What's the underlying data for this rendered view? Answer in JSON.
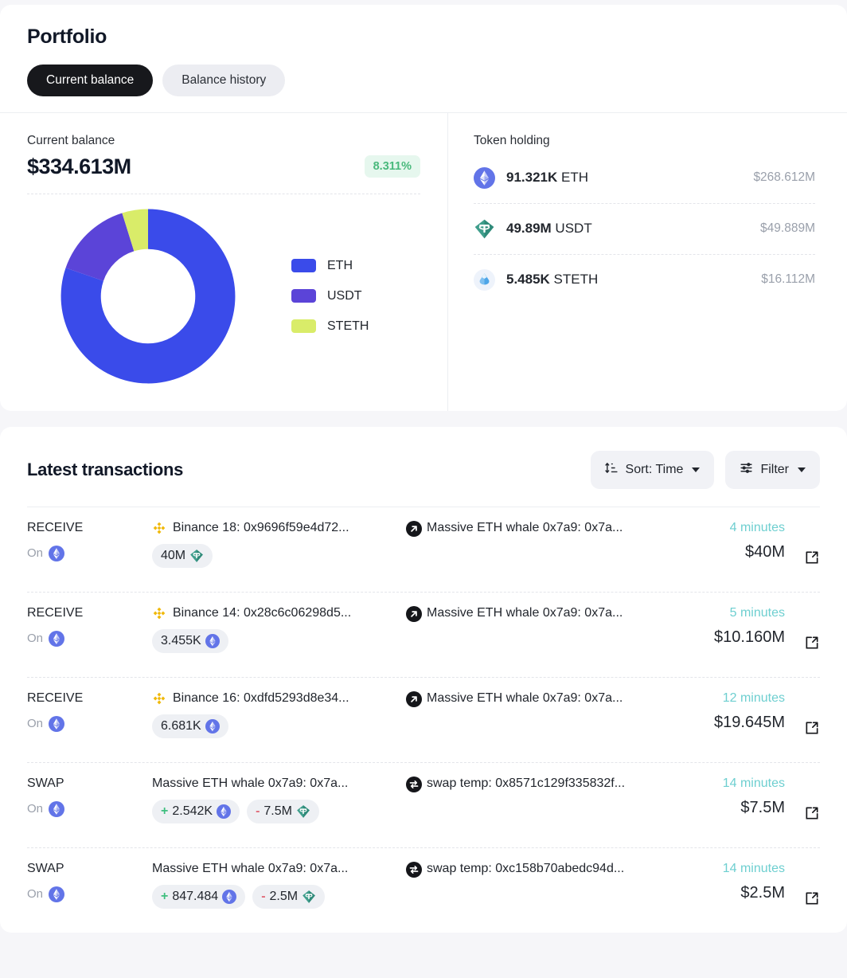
{
  "portfolio": {
    "title": "Portfolio",
    "tabs": [
      {
        "label": "Current balance",
        "active": true
      },
      {
        "label": "Balance history",
        "active": false
      }
    ],
    "balance": {
      "label": "Current balance",
      "amount": "$334.613M",
      "change": "8.311%",
      "change_color": "#49b97c"
    },
    "token_holding": {
      "title": "Token holding",
      "rows": [
        {
          "amount": "91.321K",
          "symbol": "ETH",
          "usd": "$268.612M",
          "icon": "eth-icon"
        },
        {
          "amount": "49.89M",
          "symbol": "USDT",
          "usd": "$49.889M",
          "icon": "usdt-icon"
        },
        {
          "amount": "5.485K",
          "symbol": "STETH",
          "usd": "$16.112M",
          "icon": "steth-icon"
        }
      ]
    }
  },
  "chart_data": {
    "type": "pie",
    "title": "Current balance composition",
    "labels": [
      "ETH",
      "USDT",
      "STETH"
    ],
    "values": [
      268.612,
      49.889,
      16.112
    ],
    "percentages": [
      80.3,
      14.9,
      4.8
    ],
    "colors": [
      "#3a4bea",
      "#5b44d8",
      "#d9ec69"
    ],
    "unit": "USD millions",
    "donut": true,
    "legend_position": "right"
  },
  "transactions": {
    "title": "Latest transactions",
    "sort_label": "Sort: Time",
    "filter_label": "Filter",
    "on_label": "On",
    "rows": [
      {
        "type": "RECEIVE",
        "chain_icon": "eth-icon",
        "from": "Binance 18: 0x9696f59e4d72...",
        "from_icon": "binance-icon",
        "to": "Massive ETH whale 0x7a9: 0x7a...",
        "to_icon": "arrow-up-right-icon",
        "amounts": [
          {
            "sign": "",
            "value": "40M",
            "token": "usdt-icon"
          }
        ],
        "time": "4 minutes",
        "usd": "$40M"
      },
      {
        "type": "RECEIVE",
        "chain_icon": "eth-icon",
        "from": "Binance 14: 0x28c6c06298d5...",
        "from_icon": "binance-icon",
        "to": "Massive ETH whale 0x7a9: 0x7a...",
        "to_icon": "arrow-up-right-icon",
        "amounts": [
          {
            "sign": "",
            "value": "3.455K",
            "token": "eth-icon"
          }
        ],
        "time": "5 minutes",
        "usd": "$10.160M"
      },
      {
        "type": "RECEIVE",
        "chain_icon": "eth-icon",
        "from": "Binance 16: 0xdfd5293d8e34...",
        "from_icon": "binance-icon",
        "to": "Massive ETH whale 0x7a9: 0x7a...",
        "to_icon": "arrow-up-right-icon",
        "amounts": [
          {
            "sign": "",
            "value": "6.681K",
            "token": "eth-icon"
          }
        ],
        "time": "12 minutes",
        "usd": "$19.645M"
      },
      {
        "type": "SWAP",
        "chain_icon": "eth-icon",
        "from": "Massive ETH whale 0x7a9: 0x7a...",
        "from_icon": "none",
        "to": "swap temp: 0x8571c129f335832f...",
        "to_icon": "swap-icon",
        "amounts": [
          {
            "sign": "+",
            "value": "2.542K",
            "token": "eth-icon"
          },
          {
            "sign": "-",
            "value": "7.5M",
            "token": "usdt-icon"
          }
        ],
        "time": "14 minutes",
        "usd": "$7.5M"
      },
      {
        "type": "SWAP",
        "chain_icon": "eth-icon",
        "from": "Massive ETH whale 0x7a9: 0x7a...",
        "from_icon": "none",
        "to": "swap temp: 0xc158b70abedc94d...",
        "to_icon": "swap-icon",
        "amounts": [
          {
            "sign": "+",
            "value": "847.484",
            "token": "eth-icon"
          },
          {
            "sign": "-",
            "value": "2.5M",
            "token": "usdt-icon"
          }
        ],
        "time": "14 minutes",
        "usd": "$2.5M"
      }
    ]
  }
}
